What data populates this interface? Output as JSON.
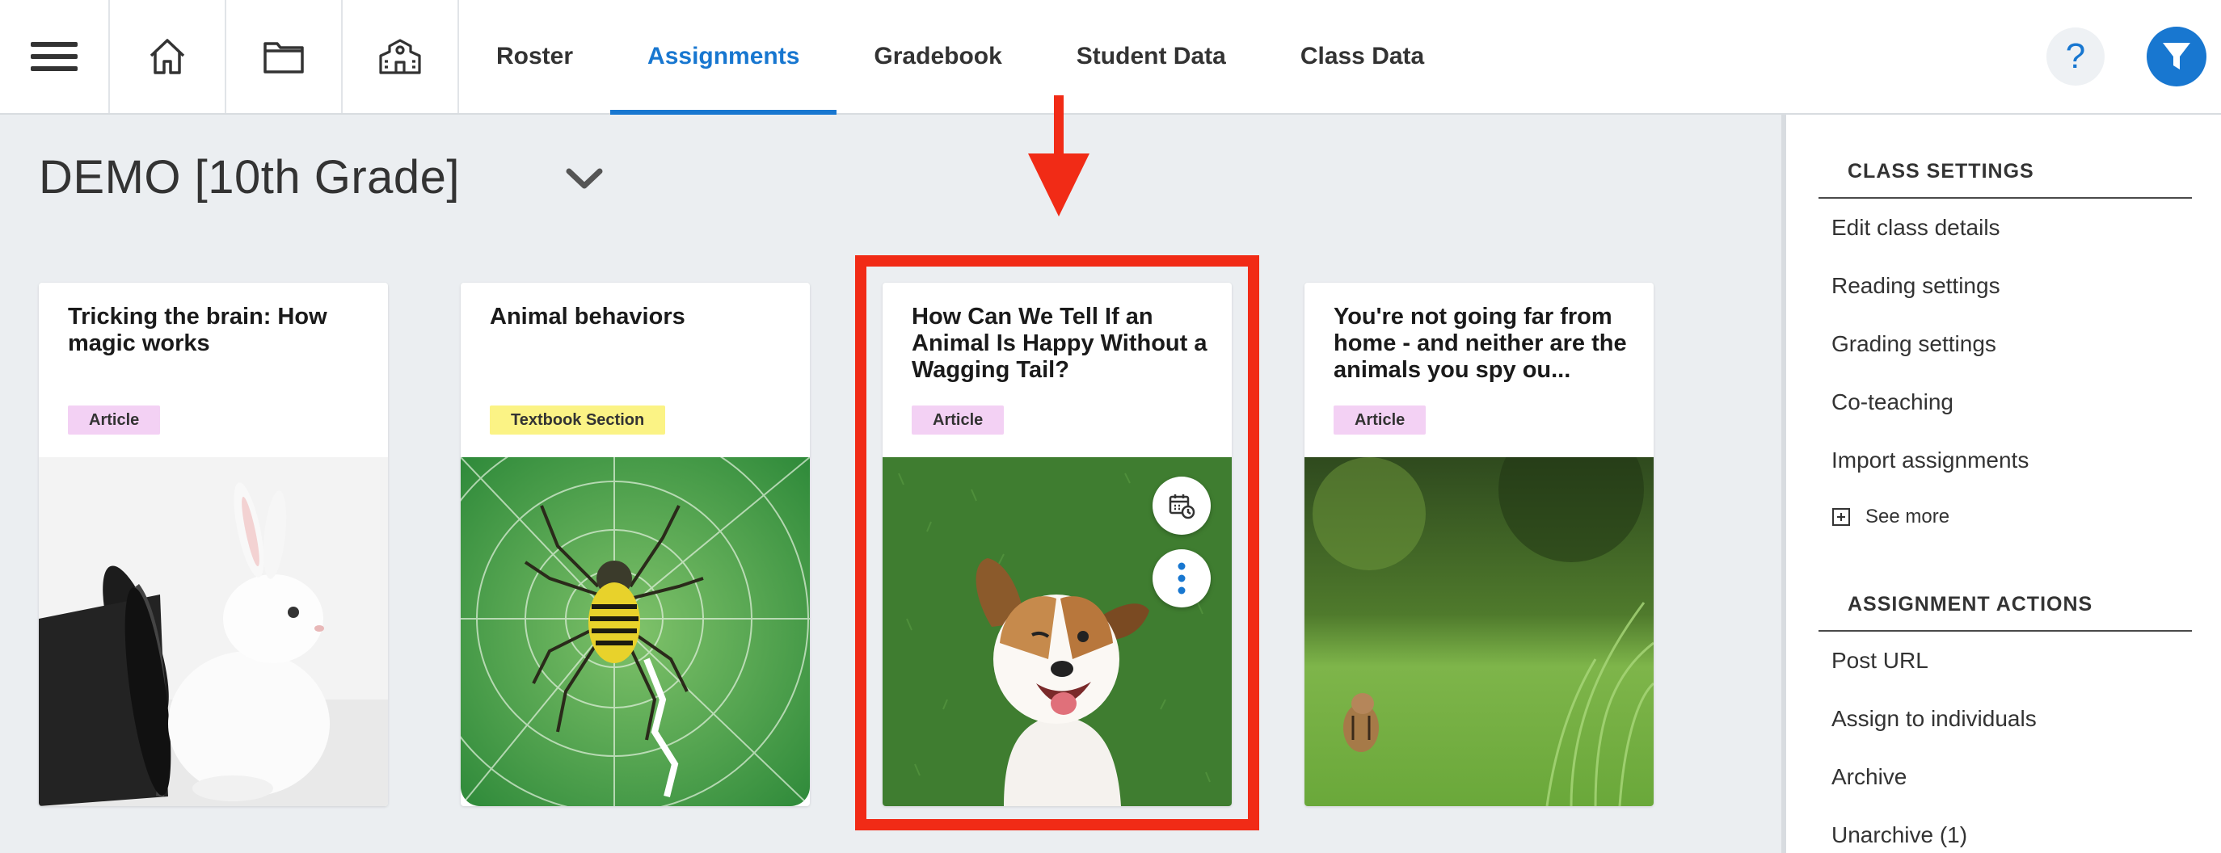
{
  "nav": {
    "icons": [
      "menu-icon",
      "home-icon",
      "folder-icon",
      "school-icon"
    ],
    "tabs": [
      "Roster",
      "Assignments",
      "Gradebook",
      "Student Data",
      "Class Data"
    ],
    "active_tab": "Assignments",
    "help_label": "?",
    "accent_color": "#1877d0"
  },
  "class_selector": {
    "title": "DEMO [10th Grade]"
  },
  "cards": [
    {
      "title": "Tricking the brain: How magic works",
      "badge": "Article",
      "image": "white rabbit beside black top hat"
    },
    {
      "title": "Animal behaviors",
      "badge": "Textbook Section",
      "image": "yellow and black spider on web"
    },
    {
      "title": "How Can We Tell If an Animal Is Happy Without a Wagging Tail?",
      "badge": "Article",
      "image": "happy dog lying on grass",
      "actions": [
        "calendar-clock-icon",
        "more-vertical-icon"
      ]
    },
    {
      "title": "You're not going far from home - and neither are the animals you spy ou...",
      "badge": "Article",
      "image": "chipmunk in green grass"
    }
  ],
  "sidebar": {
    "class_settings": {
      "heading": "CLASS SETTINGS",
      "items": [
        "Edit class details",
        "Reading settings",
        "Grading settings",
        "Co-teaching",
        "Import assignments"
      ],
      "see_more": "See more"
    },
    "assignment_actions": {
      "heading": "ASSIGNMENT ACTIONS",
      "items": [
        "Post URL",
        "Assign to individuals",
        "Archive",
        "Unarchive (1)"
      ]
    }
  },
  "annotation_color": "#f12b16"
}
